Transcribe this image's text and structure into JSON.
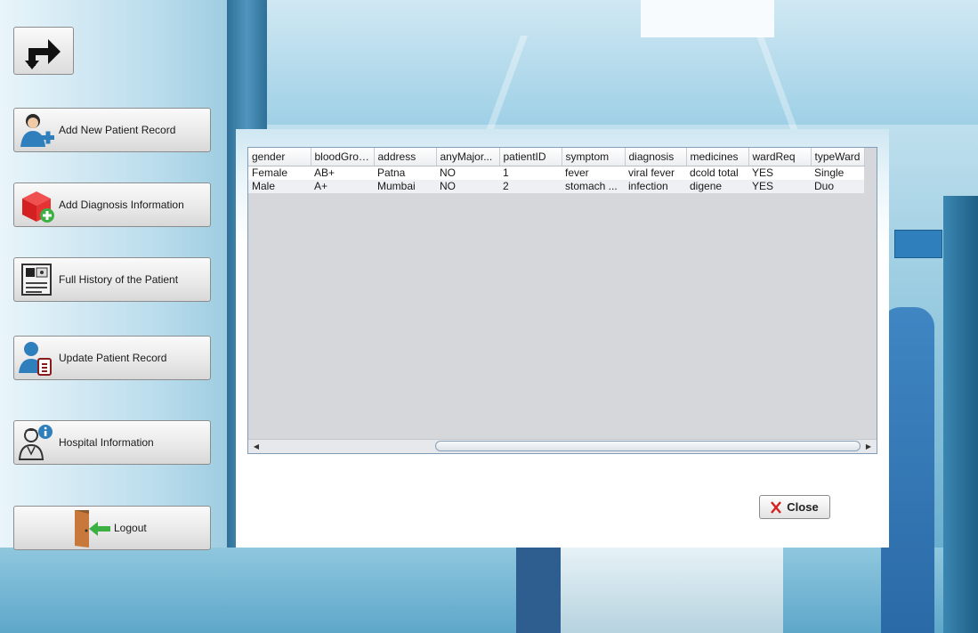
{
  "sidebar": {
    "items": [
      {
        "label": "Add New Patient Record",
        "icon": "add-user-icon"
      },
      {
        "label": "Add Diagnosis Information",
        "icon": "add-box-icon"
      },
      {
        "label": "Full History of the Patient",
        "icon": "id-card-icon"
      },
      {
        "label": "Update Patient Record",
        "icon": "user-clipboard-icon"
      },
      {
        "label": "Hospital Information",
        "icon": "doctor-info-icon"
      },
      {
        "label": "Logout",
        "icon": "exit-door-icon"
      }
    ]
  },
  "table": {
    "columns": [
      "gender",
      "bloodGroup",
      "address",
      "anyMajor...",
      "patientID",
      "symptom",
      "diagnosis",
      "medicines",
      "wardReq",
      "typeWard"
    ],
    "rows": [
      [
        "Female",
        "AB+",
        "Patna",
        "NO",
        "1",
        "fever",
        "viral fever",
        "dcold total",
        "YES",
        "Single"
      ],
      [
        "Male",
        "A+",
        "Mumbai",
        "NO",
        "2",
        "stomach ...",
        "infection",
        "digene",
        "YES",
        "Duo"
      ]
    ]
  },
  "dialog": {
    "close_label": "Close"
  },
  "colors": {
    "accent_blue": "#2f7fbd",
    "close_x": "#d61f1f",
    "add_green": "#3cb043"
  }
}
